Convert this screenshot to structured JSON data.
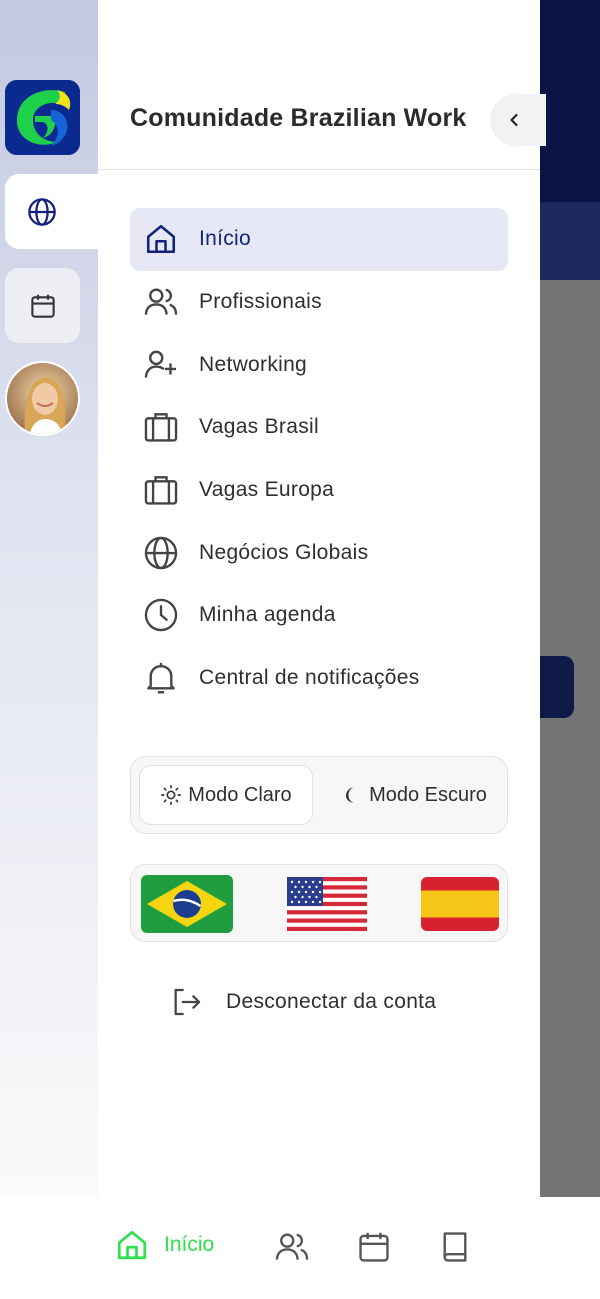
{
  "colors": {
    "accent": "#14237a",
    "active_bg": "#e6e9f5",
    "nav_active": "#2ee04b",
    "header_dark": "#0a1445"
  },
  "drawer": {
    "title": "Comunidade Brazilian Work",
    "collapse_icon": "chevron-left-icon",
    "menu": [
      {
        "label": "Início",
        "icon": "home-icon",
        "active": true
      },
      {
        "label": "Profissionais",
        "icon": "users-icon",
        "active": false
      },
      {
        "label": "Networking",
        "icon": "user-plus-icon",
        "active": false
      },
      {
        "label": "Vagas Brasil",
        "icon": "briefcase-icon",
        "active": false
      },
      {
        "label": "Vagas Europa",
        "icon": "briefcase-icon",
        "active": false
      },
      {
        "label": "Negócios Globais",
        "icon": "globe-icon",
        "active": false
      },
      {
        "label": "Minha agenda",
        "icon": "clock-icon",
        "active": false
      },
      {
        "label": "Central de notificações",
        "icon": "bell-icon",
        "active": false
      }
    ],
    "theme": {
      "light_label": "Modo Claro",
      "dark_label": "Modo Escuro",
      "selected": "light"
    },
    "languages": [
      "brazil-flag-icon",
      "usa-flag-icon",
      "spain-flag-icon"
    ],
    "logout_label": "Desconectar da conta"
  },
  "rail": {
    "items": [
      "logo",
      "globe-icon",
      "calendar-icon",
      "avatar"
    ],
    "selected": "globe-icon"
  },
  "bottom_nav": {
    "home_label": "Início",
    "items": [
      "home-icon",
      "users-icon",
      "calendar-icon",
      "book-icon"
    ]
  }
}
